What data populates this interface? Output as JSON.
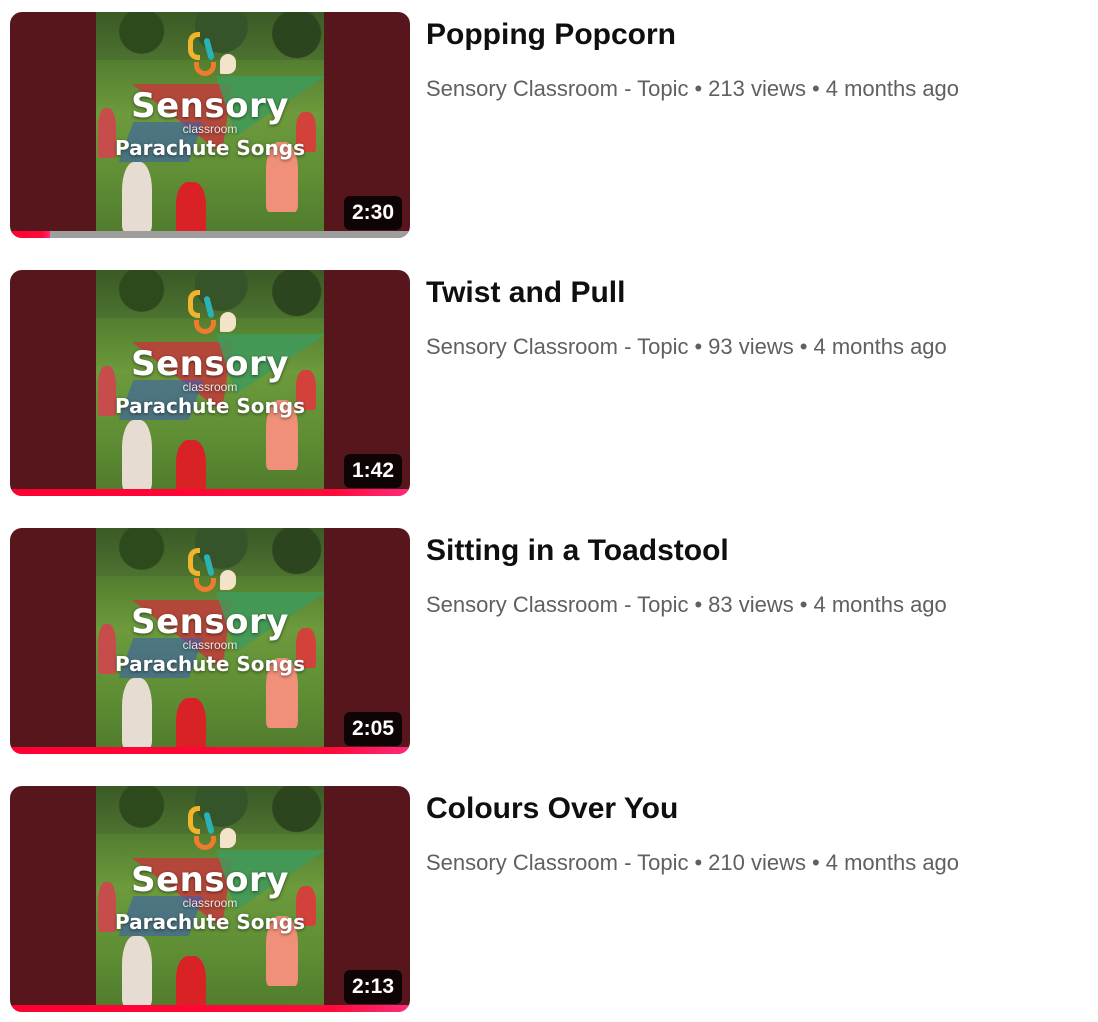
{
  "thumbnail": {
    "brand_title": "Sensory",
    "brand_small": "classroom",
    "brand_subtitle": "Parachute Songs"
  },
  "colors": {
    "thumb_background": "#57161c",
    "progress_red": "#ff0033",
    "title_text": "#0f0f0f",
    "meta_text": "#606060"
  },
  "videos": [
    {
      "title": "Popping Popcorn",
      "channel": "Sensory Classroom - Topic",
      "views": "213 views",
      "age": "4 months ago",
      "duration": "2:30",
      "progress": 0.1
    },
    {
      "title": "Twist and Pull",
      "channel": "Sensory Classroom - Topic",
      "views": "93 views",
      "age": "4 months ago",
      "duration": "1:42",
      "progress": 1.0
    },
    {
      "title": "Sitting in a Toadstool",
      "channel": "Sensory Classroom - Topic",
      "views": "83 views",
      "age": "4 months ago",
      "duration": "2:05",
      "progress": 1.0
    },
    {
      "title": "Colours Over You",
      "channel": "Sensory Classroom - Topic",
      "views": "210 views",
      "age": "4 months ago",
      "duration": "2:13",
      "progress": 1.0
    }
  ],
  "separator": "•"
}
